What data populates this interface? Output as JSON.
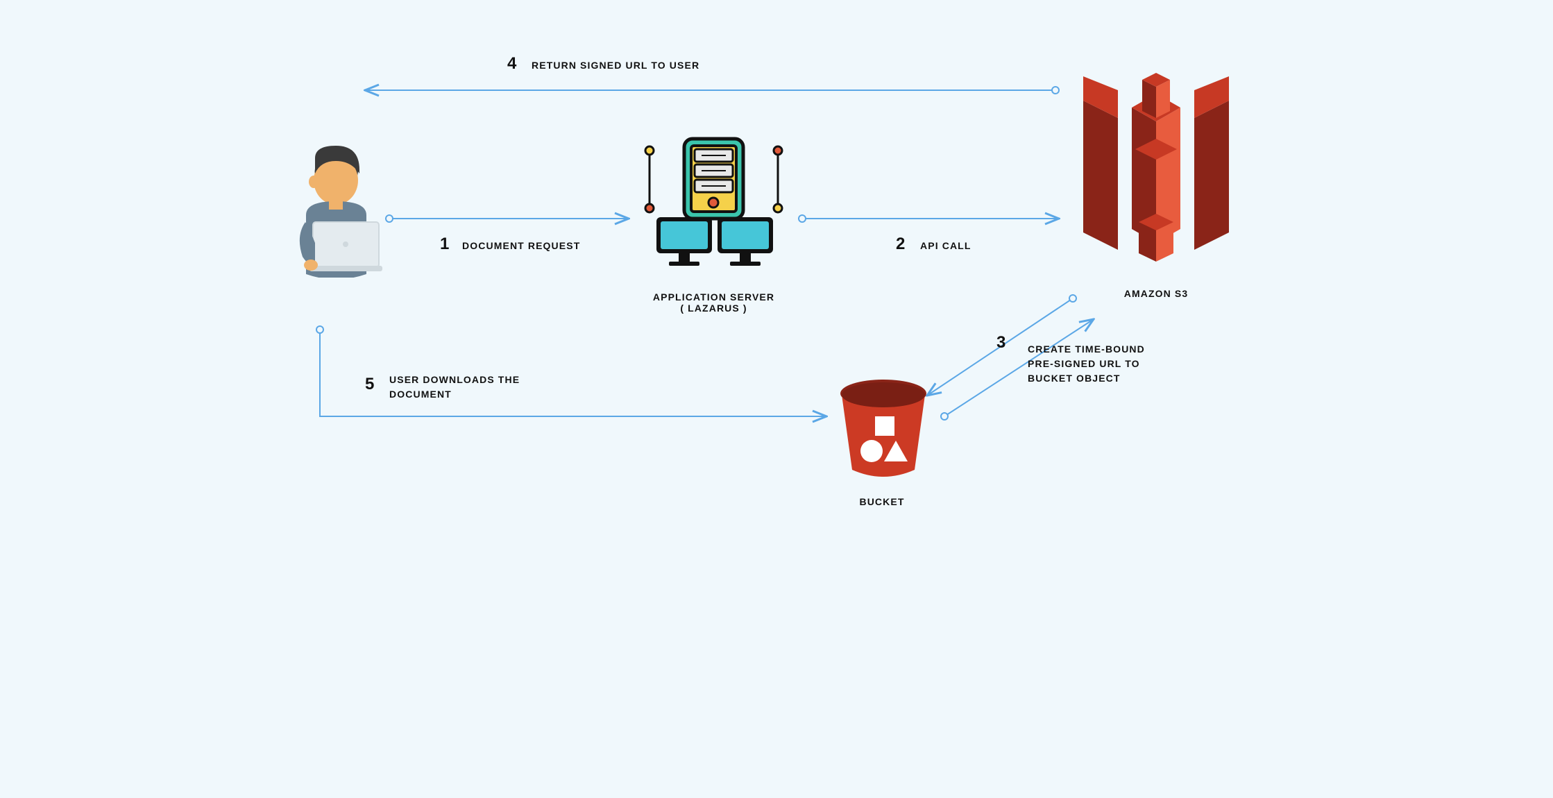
{
  "nodes": {
    "user": {
      "label": ""
    },
    "app_server": {
      "label_line1": "APPLICATION SERVER",
      "label_line2": "( LAZARUS )"
    },
    "s3": {
      "label": "AMAZON S3"
    },
    "bucket": {
      "label": "BUCKET"
    }
  },
  "steps": {
    "s1": {
      "num": "1",
      "label": "DOCUMENT REQUEST"
    },
    "s2": {
      "num": "2",
      "label": "API CALL"
    },
    "s3": {
      "num": "3",
      "label_line1": "CREATE TIME-BOUND",
      "label_line2": "PRE-SIGNED URL TO",
      "label_line3": "BUCKET OBJECT"
    },
    "s4": {
      "num": "4",
      "label": "RETURN SIGNED URL TO USER"
    },
    "s5": {
      "num": "5",
      "label_line1": "USER DOWNLOADS THE",
      "label_line2": "DOCUMENT"
    }
  },
  "colors": {
    "arrow": "#5ba7e6",
    "s3_red": "#c73924",
    "bucket_red": "#cc3a24"
  }
}
